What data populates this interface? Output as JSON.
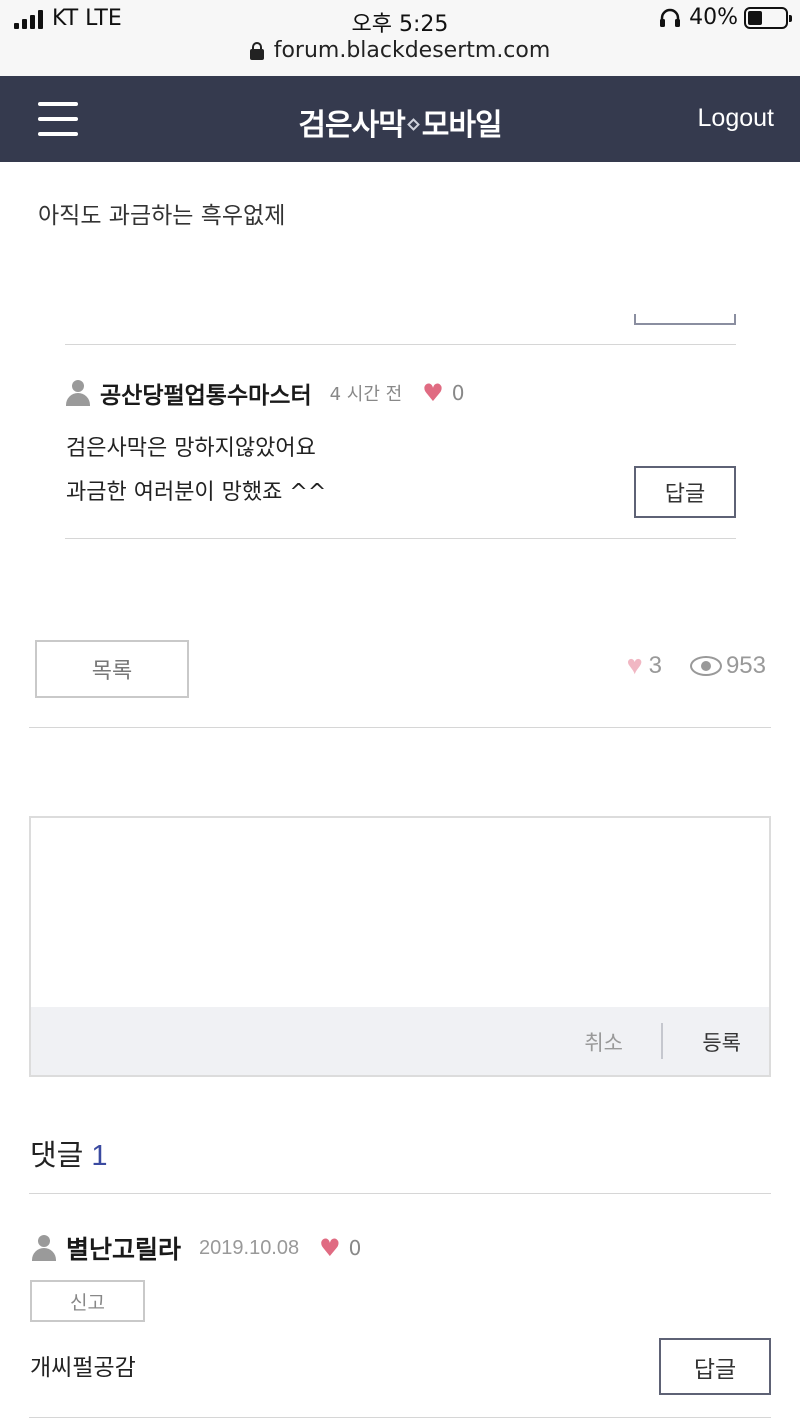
{
  "status_bar": {
    "carrier": "KT LTE",
    "time": "오후 5:25",
    "battery": "40%",
    "battery_level": 0.4,
    "url": "forum.blackdesertm.com"
  },
  "header": {
    "logo_left": "검은사막",
    "logo_right": "모바일",
    "logout": "Logout"
  },
  "post": {
    "body": "아직도 과금하는 흑우없제"
  },
  "reply": {
    "author": "공산당펄업통수마스터",
    "time": "4 시간 전",
    "likes": "0",
    "line1": "검은사막은 망하지않았어요",
    "line2": "과금한 여러분이 망했죠 ^^",
    "reply_button": "답글"
  },
  "post_actions": {
    "list_button": "목록",
    "likes": "3",
    "views": "953"
  },
  "editor": {
    "placeholder": "",
    "cancel": "취소",
    "submit": "등록"
  },
  "comments": {
    "title": "댓글",
    "count": "1",
    "items": [
      {
        "author": "별난고릴라",
        "date": "2019.10.08",
        "likes": "0",
        "report": "신고",
        "text": "개씨펄공감",
        "reply_button": "답글"
      }
    ]
  }
}
